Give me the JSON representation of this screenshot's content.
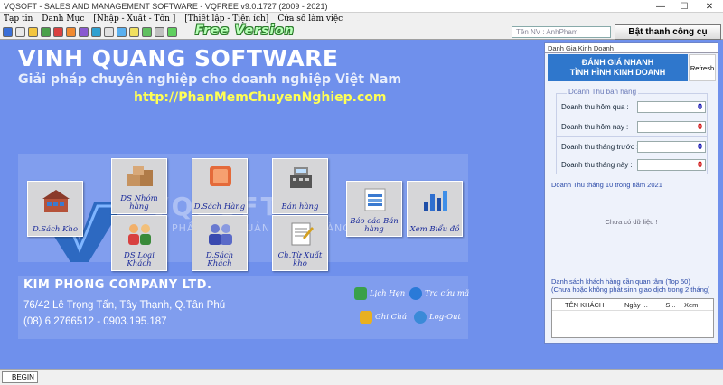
{
  "window": {
    "title": "VQSOFT - SALES AND MANAGEMENT SOFTWARE - VQFREE v9.0.1727 (2009 - 2021)",
    "min": "—",
    "max": "☐",
    "close": "✕"
  },
  "menu": [
    "Tạp tin",
    "Danh Mục",
    "[Nhập - Xuất - Tồn ]",
    "[Thiết lập - Tiện ích]",
    "Cửa số làm việc"
  ],
  "toolbar": {
    "free_version": "Free Version",
    "staff_field": "Tên NV : AnhPham",
    "tools_button": "Bật thanh công cụ"
  },
  "brand": {
    "title": "VINH QUANG SOFTWARE",
    "subtitle": "Giải pháp chuyên nghiệp cho doanh nghiệp Việt Nam",
    "url": "http://PhanMemChuyenNghiep.com",
    "watermark": "VQSOFT",
    "watermark2": "PHẦN MỀM QUẢN LÝ BÁN HÀNG"
  },
  "tiles": {
    "ds_kho": "D.Sách Kho",
    "ds_nhom_hang": "DS Nhóm hàng",
    "ds_loai_khach": "DS Loại Khách",
    "ds_hang": "D.Sách Hàng",
    "ds_khach": "D.Sách Khách",
    "ban_hang": "Bán hàng",
    "ch_tu_xuat_kho": "Ch.Từ Xuất kho",
    "bao_cao_ban_hang": "Báo cáo Bán hàng",
    "xem_bieu_do": "Xem Biểu đồ"
  },
  "company": {
    "name": "KIM PHONG COMPANY LTD.",
    "address": "76/42 Lê Trọng Tấn, Tây Thạnh, Q.Tân Phú",
    "phone": "(08) 6 2766512 - 0903.195.187"
  },
  "quick_buttons": {
    "lich_hen": "Lịch Hẹn",
    "tra_cuu_ma": "Tra cứu mã",
    "ghi_chu": "Ghi Chú",
    "log_out": "Log-Out"
  },
  "status": {
    "begin": "BEGIN"
  },
  "panel": {
    "header": "Danh Gia Kinh Doanh",
    "headline_line1": "ĐÁNH GIÁ NHANH",
    "headline_line2": "TÌNH HÌNH KINH DOANH",
    "refresh": "Refresh",
    "group_caption": "Doanh Thu bán hàng",
    "rows": [
      {
        "label": "Doanh thu hôm qua :",
        "value": "0"
      },
      {
        "label": "Doanh thu hôm nay :",
        "value": "0"
      },
      {
        "label": "Doanh thu tháng trước :",
        "value": "0"
      },
      {
        "label": "Doanh thu tháng này :",
        "value": "0"
      }
    ],
    "chart_title": "Doanh Thu tháng 10 trong năm 2021",
    "no_data": "Chưa có dữ liệu !",
    "customers_title": "Danh sách khách hàng cần quan tâm (Top 50)",
    "customers_subtitle": "(Chưa hoặc không phát sinh giao dịch trong 2 tháng)",
    "columns": [
      "TÊN KHÁCH",
      "Ngày ...",
      "S...",
      "Xem"
    ]
  },
  "colors": {
    "background": "#6f90ec",
    "accent_blue": "#2f77cc",
    "value_red": "#cc0000",
    "value_blue": "#0000aa"
  }
}
